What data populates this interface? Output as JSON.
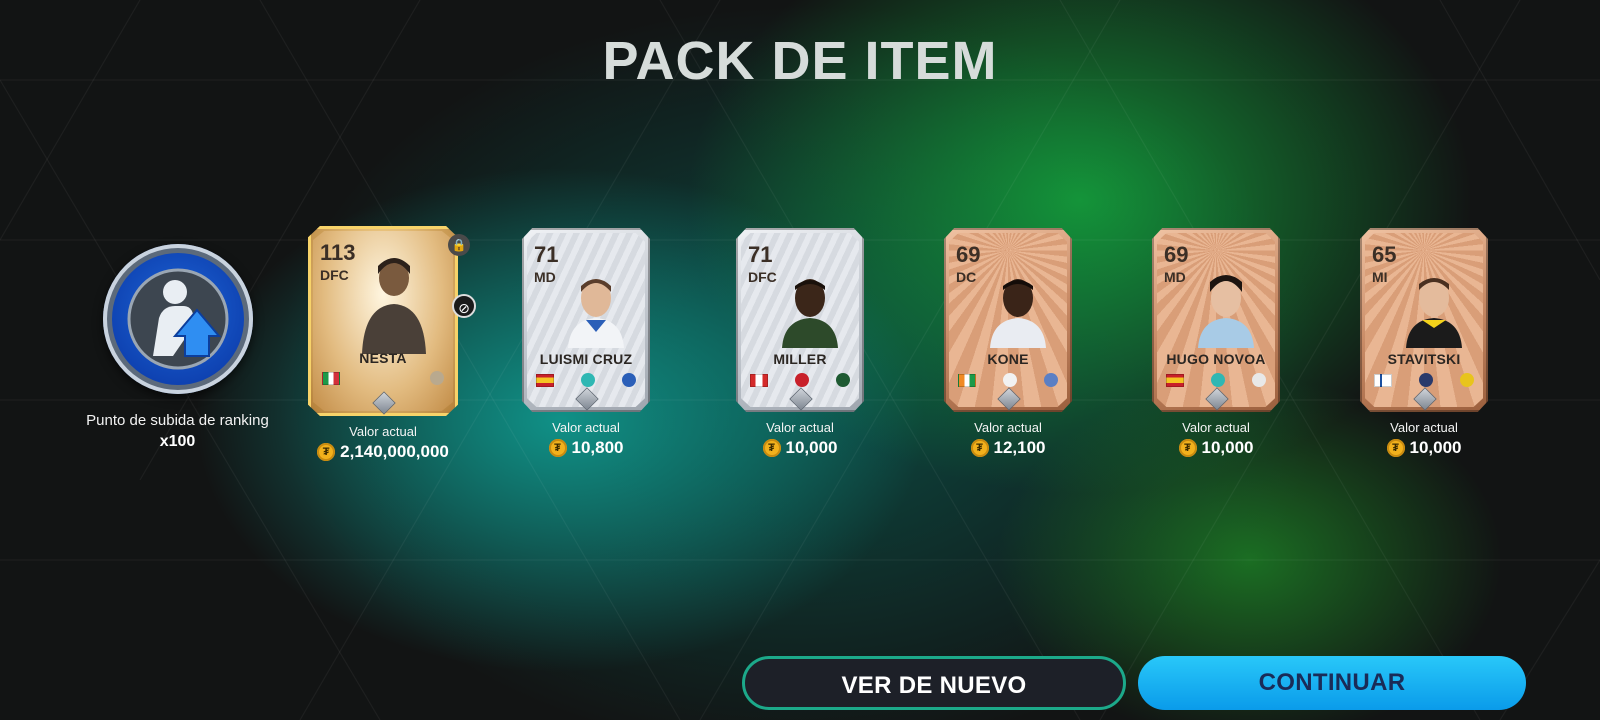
{
  "title": "PACK DE ITEM",
  "rank_item": {
    "label": "Punto de subida de ranking",
    "quantity": "x100"
  },
  "value_label": "Valor actual",
  "players": [
    {
      "ovr": "113",
      "pos": "DFC",
      "name": "NESTA",
      "value": "2,140,000,000",
      "tier": "legend",
      "flag": "italy",
      "locked": true,
      "untradeable": true
    },
    {
      "ovr": "71",
      "pos": "MD",
      "name": "LUISMI CRUZ",
      "value": "10,800",
      "tier": "silver",
      "flag": "spain"
    },
    {
      "ovr": "71",
      "pos": "DFC",
      "name": "MILLER",
      "value": "10,000",
      "tier": "silver",
      "flag": "canada"
    },
    {
      "ovr": "69",
      "pos": "DC",
      "name": "KONE",
      "value": "12,100",
      "tier": "bronze",
      "flag": "ireland"
    },
    {
      "ovr": "69",
      "pos": "MD",
      "name": "HUGO NOVOA",
      "value": "10,000",
      "tier": "bronze",
      "flag": "spain"
    },
    {
      "ovr": "65",
      "pos": "MI",
      "name": "STAVITSKI",
      "value": "10,000",
      "tier": "bronze",
      "flag": "finland"
    }
  ],
  "buttons": {
    "again": "VER DE NUEVO",
    "continue": "CONTINUAR"
  },
  "colors": {
    "accent_green": "#1ca98a",
    "continue_blue": "#0a9bea",
    "coin_gold": "#f2b11c"
  },
  "icons": {
    "coin": "coin-icon",
    "lock": "lock-icon",
    "untradeable": "untradeable-icon",
    "rank_up": "rank-up-icon"
  }
}
